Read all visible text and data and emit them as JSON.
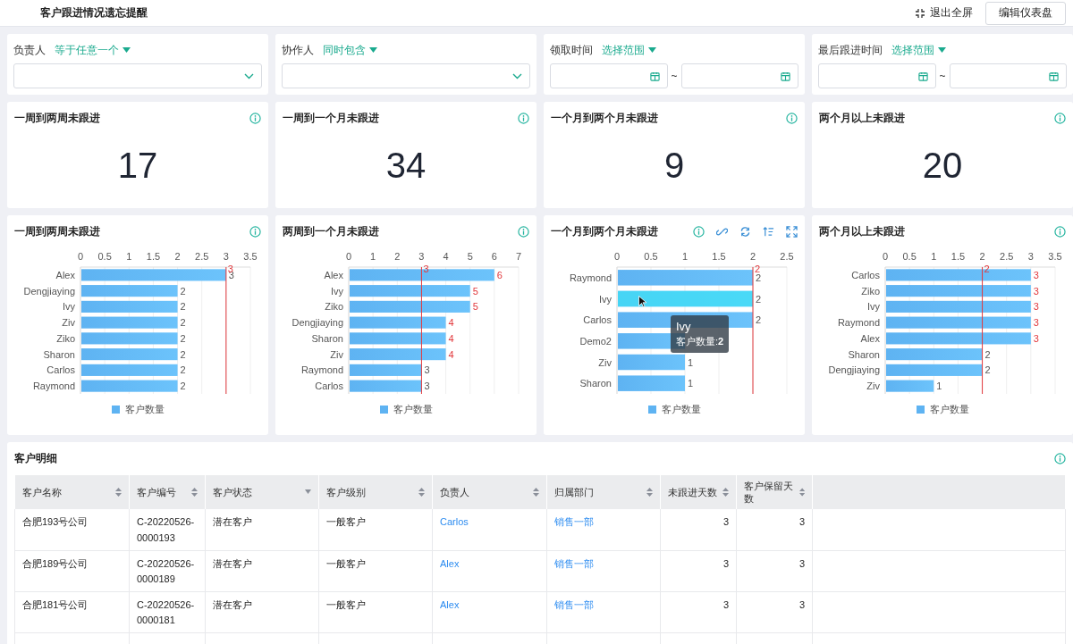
{
  "header": {
    "title": "客户跟进情况遗忘提醒",
    "actions": [
      {
        "kind": "exit_fullscreen",
        "label": "退出全屏"
      },
      {
        "kind": "button",
        "label": "编辑仪表盘"
      }
    ]
  },
  "filters": [
    {
      "label": "负责人",
      "operator": "等于任意一个",
      "kind": "select"
    },
    {
      "label": "协作人",
      "operator": "同时包含",
      "kind": "select"
    },
    {
      "label": "领取时间",
      "operator": "选择范围",
      "kind": "date_range",
      "separator": "~"
    },
    {
      "label": "最后跟进时间",
      "operator": "选择范围",
      "kind": "date_range",
      "separator": "~"
    }
  ],
  "kpis": [
    {
      "title": "一周到两周未跟进",
      "value": "17"
    },
    {
      "title": "一周到一个月未跟进",
      "value": "34"
    },
    {
      "title": "一个月到两个月未跟进",
      "value": "9"
    },
    {
      "title": "两个月以上未跟进",
      "value": "20"
    }
  ],
  "charts": [
    {
      "title": "一周到两周未跟进",
      "tools": [
        {
          "kind": "info"
        }
      ],
      "chart_data": {
        "type": "bar",
        "orientation": "horizontal",
        "categories": [
          "Alex",
          "Dengjiaying",
          "Ivy",
          "Ziv",
          "Ziko",
          "Sharon",
          "Carlos",
          "Raymond"
        ],
        "series": [
          {
            "name": "客户数量",
            "color": "#5eb3f2",
            "values": [
              3,
              2,
              2,
              2,
              2,
              2,
              2,
              2
            ]
          }
        ],
        "xlim": [
          0,
          3.5
        ],
        "xticks": [
          0,
          {
            "value": 0.5,
            "label": "0.5"
          },
          1,
          {
            "value": 1.5,
            "label": "1.5"
          },
          2,
          {
            "value": 2.5,
            "label": "2.5"
          },
          3,
          {
            "value": 3.5,
            "label": "3.5"
          }
        ],
        "data_labels": true,
        "grid": true,
        "ref_lines": [
          {
            "value": 3,
            "axis": "x",
            "label": "3",
            "color": "#e2393d"
          }
        ]
      }
    },
    {
      "title": "两周到一个月未跟进",
      "tools": [
        {
          "kind": "info"
        }
      ],
      "chart_data": {
        "type": "bar",
        "orientation": "horizontal",
        "categories": [
          "Alex",
          "Ivy",
          "Ziko",
          "Dengjiaying",
          "Sharon",
          "Ziv",
          "Raymond",
          "Carlos"
        ],
        "series": [
          {
            "name": "客户数量",
            "color": "#5eb3f2",
            "values": [
              6,
              5,
              5,
              4,
              4,
              4,
              3,
              3
            ]
          }
        ],
        "xlim": [
          0,
          7
        ],
        "xticks": [
          0,
          1,
          2,
          3,
          4,
          5,
          6,
          7
        ],
        "data_labels": true,
        "grid": true,
        "ref_lines": [
          {
            "value": 3,
            "axis": "x",
            "label": "3",
            "color": "#e2393d"
          }
        ]
      }
    },
    {
      "title": "一个月到两个月未跟进",
      "tools": [
        {
          "kind": "info"
        },
        {
          "kind": "link"
        },
        {
          "kind": "refresh"
        },
        {
          "kind": "sort"
        },
        {
          "kind": "fullscreen"
        }
      ],
      "bar_hover": [
        false,
        true,
        false,
        false,
        false,
        false
      ],
      "tooltip": {
        "title": "Ivy",
        "text": "客户数量:**2**"
      },
      "chart_data": {
        "type": "bar",
        "orientation": "horizontal",
        "categories": [
          "Raymond",
          "Ivy",
          "Carlos",
          "Demo2",
          "Ziv",
          "Sharon"
        ],
        "series": [
          {
            "name": "客户数量",
            "color": "#5eb3f2",
            "values": [
              2,
              2,
              2,
              1,
              1,
              1
            ]
          }
        ],
        "xlim": [
          0,
          2.5
        ],
        "xticks": [
          0,
          {
            "value": 0.5,
            "label": "0.5"
          },
          1,
          {
            "value": 1.5,
            "label": "1.5"
          },
          2,
          {
            "value": 2.5,
            "label": "2.5"
          }
        ],
        "value_labels": [
          "2",
          "2",
          "2",
          null,
          "1",
          "1"
        ],
        "grid": true,
        "ref_lines": [
          {
            "value": 2,
            "axis": "x",
            "label": "2",
            "color": "#e2393d"
          }
        ]
      }
    },
    {
      "title": "两个月以上未跟进",
      "tools": [
        {
          "kind": "info"
        }
      ],
      "chart_data": {
        "type": "bar",
        "orientation": "horizontal",
        "categories": [
          "Carlos",
          "Ziko",
          "Ivy",
          "Raymond",
          "Alex",
          "Sharon",
          "Dengjiaying",
          "Ziv"
        ],
        "series": [
          {
            "name": "客户数量",
            "color": "#5eb3f2",
            "values": [
              3,
              3,
              3,
              3,
              3,
              2,
              2,
              1
            ]
          }
        ],
        "xlim": [
          0,
          3.5
        ],
        "xticks": [
          0,
          {
            "value": 0.5,
            "label": "0.5"
          },
          1,
          {
            "value": 1.5,
            "label": "1.5"
          },
          2,
          {
            "value": 2.5,
            "label": "2.5"
          },
          3,
          {
            "value": 3.5,
            "label": "3.5"
          }
        ],
        "data_labels": true,
        "grid": true,
        "ref_lines": [
          {
            "value": 2,
            "axis": "x",
            "label": "2",
            "color": "#e2393d"
          }
        ]
      }
    }
  ],
  "table": {
    "title": "客户明细",
    "columns": [
      {
        "label": "客户名称",
        "kind": "text",
        "sortable": true,
        "filterable": false
      },
      {
        "label": "客户编号",
        "kind": "text",
        "sortable": true,
        "filterable": false
      },
      {
        "label": "客户状态",
        "kind": "text",
        "sortable": false,
        "filterable": true
      },
      {
        "label": "客户级别",
        "kind": "text",
        "sortable": true,
        "filterable": false
      },
      {
        "label": "负责人",
        "kind": "link",
        "sortable": true,
        "filterable": false
      },
      {
        "label": "归属部门",
        "kind": "link",
        "sortable": true,
        "filterable": false
      },
      {
        "label": "未跟进天数",
        "kind": "number",
        "sortable": true,
        "filterable": false
      },
      {
        "label": "客户保留天数",
        "kind": "number",
        "sortable": true,
        "filterable": false
      }
    ],
    "rows": [
      [
        "合肥193号公司",
        "C-20220526-0000193",
        "潜在客户",
        "一般客户",
        "Carlos",
        "销售一部",
        "3",
        "3"
      ],
      [
        "合肥189号公司",
        "C-20220526-0000189",
        "潜在客户",
        "一般客户",
        "Alex",
        "销售一部",
        "3",
        "3"
      ],
      [
        "合肥181号公司",
        "C-20220526-0000181",
        "潜在客户",
        "一般客户",
        "Alex",
        "销售一部",
        "3",
        "3"
      ]
    ]
  }
}
